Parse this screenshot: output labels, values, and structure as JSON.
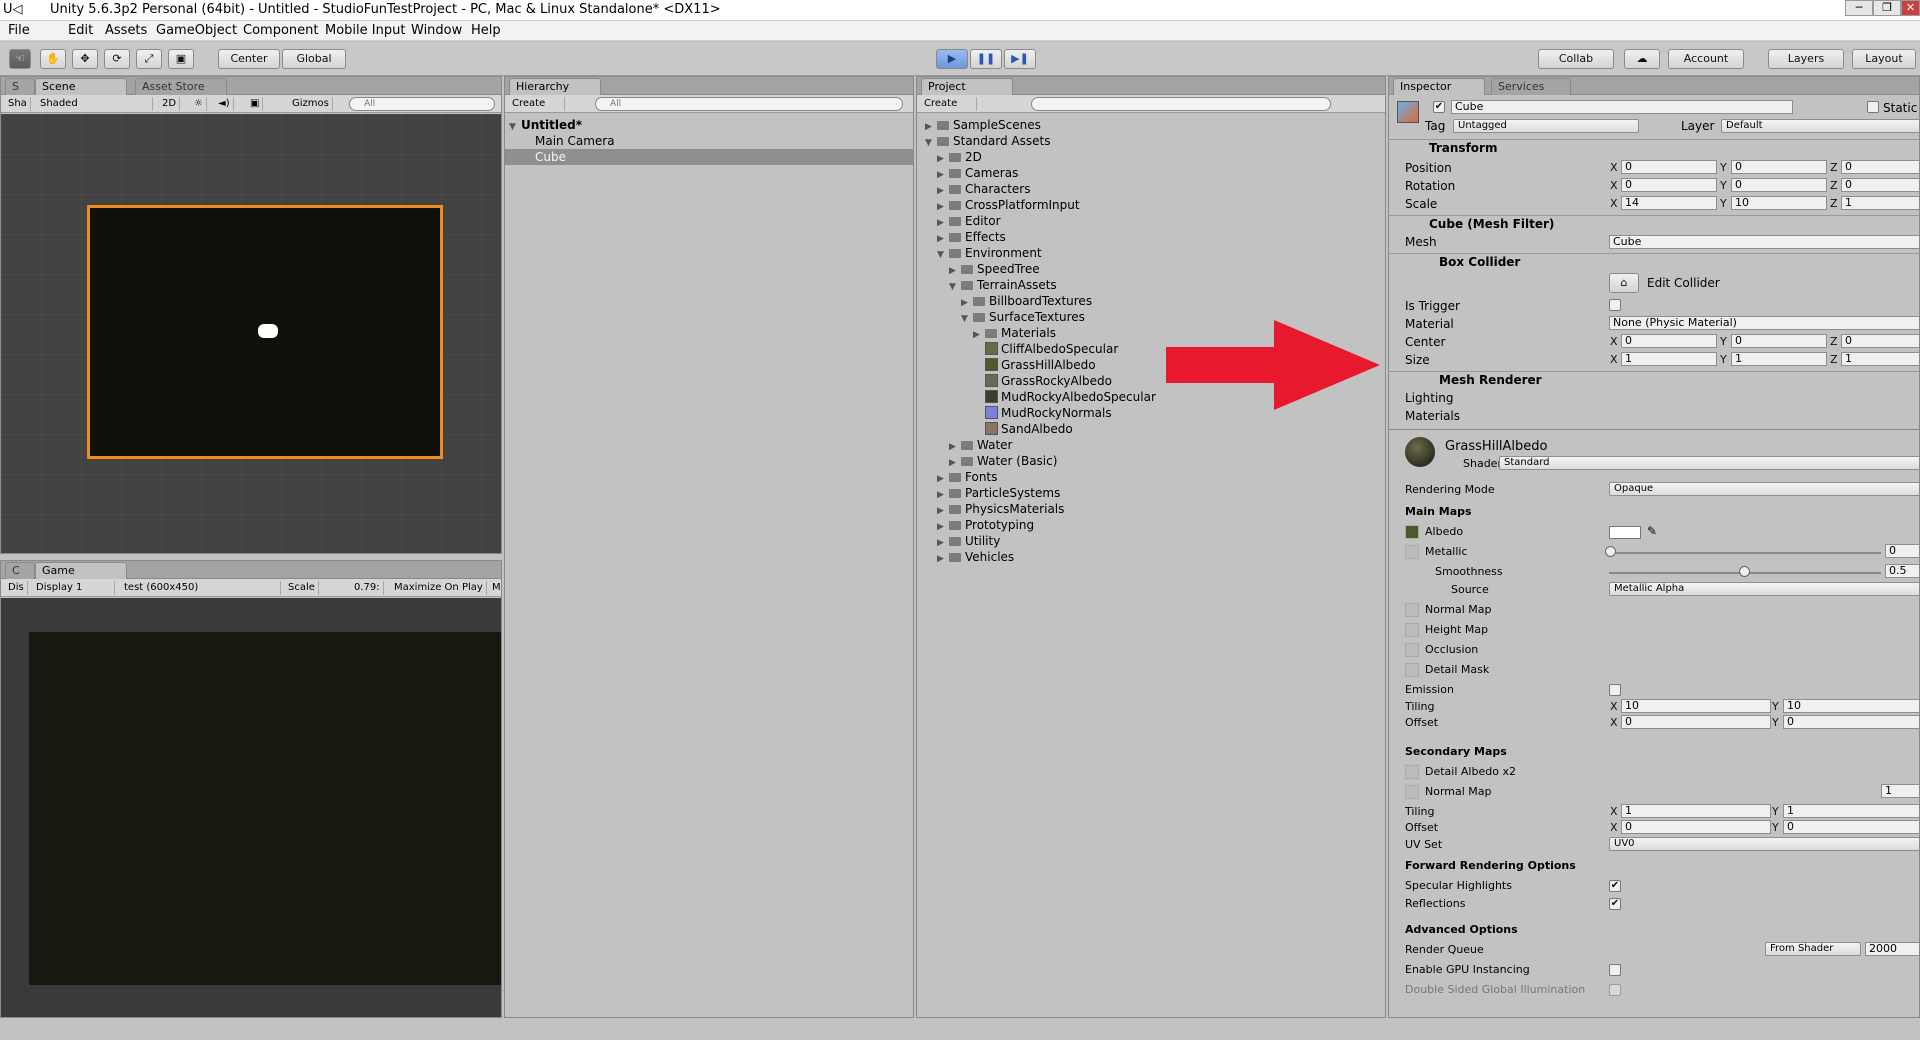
{
  "window": {
    "title": "Unity 5.6.3p2 Personal (64bit) - Untitled - StudioFunTestProject - PC, Mac & Linux Standalone* <DX11>",
    "logo": "U◁",
    "buttons": [
      "─",
      "❐",
      "✕"
    ]
  },
  "menu": [
    "File",
    "Edit",
    "Assets",
    "GameObject",
    "Component",
    "Mobile Input",
    "Window",
    "Help"
  ],
  "toolbar": {
    "center": "Center",
    "global": "Global",
    "collab": "Collab",
    "account": "Account",
    "layers": "Layers",
    "layout": "Layout",
    "tools": [
      "☜",
      "✋",
      "✥",
      "⟳",
      "⤢",
      "▣"
    ],
    "play": "▶",
    "pause": "❚❚",
    "step": "▶❚",
    "cloud": "☁"
  },
  "scene": {
    "tab": "S",
    "scene_tab": "Scene",
    "asset_store": "Asset Store",
    "sub": [
      "Sha",
      "Shaded",
      "2D",
      "☼",
      "◄)",
      "▣",
      "Gizmos"
    ],
    "search": "All"
  },
  "game": {
    "tab": "C",
    "game_tab": "Game",
    "sub": [
      "Dis",
      "Display 1",
      "test (600x450)",
      "Scale",
      "0.79:",
      "Maximize On Play",
      "M"
    ]
  },
  "hierarchy": {
    "tab": "Hierarchy",
    "create": "Create",
    "search": "All",
    "root": "Untitled*",
    "items": [
      "Main Camera",
      "Cube"
    ]
  },
  "project": {
    "tab": "Project",
    "create": "Create",
    "tree": [
      {
        "t": "SampleScenes",
        "d": 0,
        "a": "▶",
        "k": "f"
      },
      {
        "t": "Standard Assets",
        "d": 0,
        "a": "▼",
        "k": "f"
      },
      {
        "t": "2D",
        "d": 1,
        "a": "▶",
        "k": "f"
      },
      {
        "t": "Cameras",
        "d": 1,
        "a": "▶",
        "k": "f"
      },
      {
        "t": "Characters",
        "d": 1,
        "a": "▶",
        "k": "f"
      },
      {
        "t": "CrossPlatformInput",
        "d": 1,
        "a": "▶",
        "k": "f"
      },
      {
        "t": "Editor",
        "d": 1,
        "a": "▶",
        "k": "f"
      },
      {
        "t": "Effects",
        "d": 1,
        "a": "▶",
        "k": "f"
      },
      {
        "t": "Environment",
        "d": 1,
        "a": "▼",
        "k": "f"
      },
      {
        "t": "SpeedTree",
        "d": 2,
        "a": "▶",
        "k": "f"
      },
      {
        "t": "TerrainAssets",
        "d": 2,
        "a": "▼",
        "k": "f"
      },
      {
        "t": "BillboardTextures",
        "d": 3,
        "a": "▶",
        "k": "f"
      },
      {
        "t": "SurfaceTextures",
        "d": 3,
        "a": "▼",
        "k": "f"
      },
      {
        "t": "Materials",
        "d": 4,
        "a": "▶",
        "k": "f"
      },
      {
        "t": "CliffAlbedoSpecular",
        "d": 4,
        "a": "",
        "k": "#6a6a48"
      },
      {
        "t": "GrassHillAlbedo",
        "d": 4,
        "a": "",
        "k": "#4d5a2a"
      },
      {
        "t": "GrassRockyAlbedo",
        "d": 4,
        "a": "",
        "k": "#6b6b55"
      },
      {
        "t": "MudRockyAlbedoSpecular",
        "d": 4,
        "a": "",
        "k": "#3d3a30"
      },
      {
        "t": "MudRockyNormals",
        "d": 4,
        "a": "",
        "k": "#7f7fe0"
      },
      {
        "t": "SandAlbedo",
        "d": 4,
        "a": "",
        "k": "#8a7560"
      },
      {
        "t": "Water",
        "d": 2,
        "a": "▶",
        "k": "f"
      },
      {
        "t": "Water (Basic)",
        "d": 2,
        "a": "▶",
        "k": "f"
      },
      {
        "t": "Fonts",
        "d": 1,
        "a": "▶",
        "k": "f"
      },
      {
        "t": "ParticleSystems",
        "d": 1,
        "a": "▶",
        "k": "f"
      },
      {
        "t": "PhysicsMaterials",
        "d": 1,
        "a": "▶",
        "k": "f"
      },
      {
        "t": "Prototyping",
        "d": 1,
        "a": "▶",
        "k": "f"
      },
      {
        "t": "Utility",
        "d": 1,
        "a": "▶",
        "k": "f"
      },
      {
        "t": "Vehicles",
        "d": 1,
        "a": "▶",
        "k": "f"
      }
    ]
  },
  "inspector": {
    "tab": "Inspector",
    "services": "Services",
    "object_name": "Cube",
    "static": "Static",
    "tag_label": "Tag",
    "tag": "Untagged",
    "layer_label": "Layer",
    "layer": "Default",
    "transform": {
      "title": "Transform",
      "position": "Position",
      "rotation": "Rotation",
      "scale": "Scale",
      "pos": [
        "0",
        "0",
        "0"
      ],
      "rot": [
        "0",
        "0",
        "0"
      ],
      "scl": [
        "14",
        "10",
        "1"
      ]
    },
    "mesh_filter": {
      "title": "Cube (Mesh Filter)",
      "mesh_label": "Mesh",
      "mesh": "Cube"
    },
    "box_collider": {
      "title": "Box Collider",
      "edit": "Edit Collider",
      "is_trigger": "Is Trigger",
      "material_label": "Material",
      "material": "None (Physic Material)",
      "center_label": "Center",
      "size_label": "Size",
      "center": [
        "0",
        "0",
        "0"
      ],
      "size": [
        "1",
        "1",
        "1"
      ]
    },
    "mesh_renderer": {
      "title": "Mesh Renderer",
      "lighting": "Lighting",
      "materials": "Materials"
    },
    "material": {
      "name": "GrassHillAlbedo",
      "shader_label": "Shader",
      "shader": "Standard",
      "rendering_mode_label": "Rendering Mode",
      "rendering_mode": "Opaque",
      "main_maps": "Main Maps",
      "albedo": "Albedo",
      "metallic": "Metallic",
      "metallic_val": "0",
      "smoothness": "Smoothness",
      "smoothness_val": "0.5",
      "source": "Source",
      "source_val": "Metallic Alpha",
      "normal_map": "Normal Map",
      "height_map": "Height Map",
      "occlusion": "Occlusion",
      "detail_mask": "Detail Mask",
      "emission": "Emission",
      "tiling": "Tiling",
      "offset": "Offset",
      "tiling_main": [
        "10",
        "10"
      ],
      "offset_main": [
        "0",
        "0"
      ],
      "secondary_maps": "Secondary Maps",
      "detail_albedo": "Detail Albedo x2",
      "normal_map2": "Normal Map",
      "normal_scale": "1",
      "tiling_sec": [
        "1",
        "1"
      ],
      "offset_sec": [
        "0",
        "0"
      ],
      "uv_set": "UV Set",
      "uv_set_val": "UV0",
      "forward": "Forward Rendering Options",
      "specular": "Specular Highlights",
      "reflections": "Reflections",
      "advanced": "Advanced Options",
      "render_queue": "Render Queue",
      "from_shader": "From Shader",
      "queue_val": "2000",
      "gpu": "Enable GPU Instancing",
      "double_sided": "Double Sided Global Illumination"
    }
  },
  "colors": {
    "selection_outline": "#f08c1e",
    "arrow": "#e8192c",
    "viewport": "#100f0a",
    "game_bg": "#181710"
  }
}
